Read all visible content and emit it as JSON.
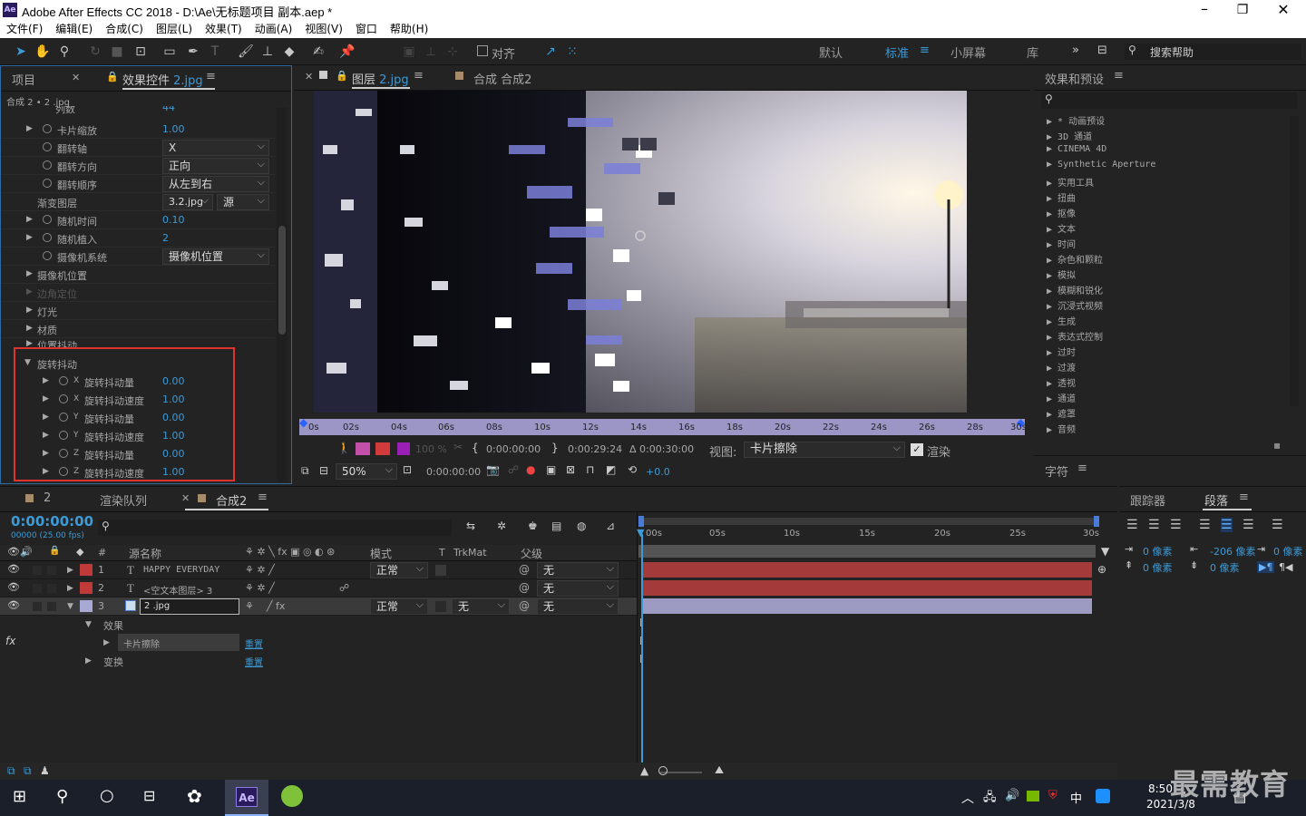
{
  "app": {
    "title": "Adobe After Effects CC 2018 - D:\\Ae\\无标题项目 副本.aep *",
    "logo": "Ae"
  },
  "menu": [
    "文件(F)",
    "编辑(E)",
    "合成(C)",
    "图层(L)",
    "效果(T)",
    "动画(A)",
    "视图(V)",
    "窗口",
    "帮助(H)"
  ],
  "toolbar": {
    "align_label": "对齐",
    "workspaces": [
      "默认",
      "标准",
      "小屏幕",
      "库"
    ],
    "search_placeholder": "搜索帮助"
  },
  "effect_controls": {
    "tab_project": "项目",
    "tab_effects": "效果控件",
    "tab_effects_file": "2.jpg",
    "breadcrumb": "合成 2 • 2 .jpg",
    "partial_row": {
      "label": "列数",
      "value": "44"
    },
    "rows": [
      {
        "label": "卡片缩放",
        "value": "1.00",
        "kind": "value"
      },
      {
        "label": "翻转轴",
        "value": "X",
        "kind": "select"
      },
      {
        "label": "翻转方向",
        "value": "正向",
        "kind": "select"
      },
      {
        "label": "翻转顺序",
        "value": "从左到右",
        "kind": "select"
      },
      {
        "label": "渐变图层",
        "value": "3.2.jpg",
        "value2": "源",
        "kind": "select2"
      },
      {
        "label": "随机时间",
        "value": "0.10",
        "kind": "value"
      },
      {
        "label": "随机植入",
        "value": "2",
        "kind": "value"
      },
      {
        "label": "摄像机系统",
        "value": "摄像机位置",
        "kind": "select"
      }
    ],
    "groups": [
      "摄像机位置",
      "边角定位",
      "灯光",
      "材质",
      "位置抖动"
    ],
    "rotation_group": "旋转抖动",
    "rotation_rows": [
      {
        "axis": "X",
        "label": "旋转抖动量",
        "value": "0.00"
      },
      {
        "axis": "X",
        "label": "旋转抖动速度",
        "value": "1.00"
      },
      {
        "axis": "Y",
        "label": "旋转抖动量",
        "value": "0.00"
      },
      {
        "axis": "Y",
        "label": "旋转抖动速度",
        "value": "1.00"
      },
      {
        "axis": "Z",
        "label": "旋转抖动量",
        "value": "0.00"
      },
      {
        "axis": "Z",
        "label": "旋转抖动速度",
        "value": "1.00"
      }
    ]
  },
  "viewer": {
    "tab_layer": "图层",
    "tab_layer_file": "2.jpg",
    "tab_comp": "合成 合成2",
    "ruler_ticks": [
      "0s",
      "02s",
      "04s",
      "06s",
      "08s",
      "10s",
      "12s",
      "14s",
      "16s",
      "18s",
      "20s",
      "22s",
      "24s",
      "26s",
      "28s",
      "30s"
    ],
    "opacity": "100 %",
    "in_time": "0:00:00:00",
    "out_time": "0:00:29:24",
    "duration": "Δ 0:00:30:00",
    "view_label": "视图:",
    "view_value": "卡片擦除",
    "render_label": "渲染",
    "zoom": "50%",
    "current_time": "0:00:00:00",
    "exposure": "+0.0"
  },
  "effects_presets": {
    "title": "效果和预设",
    "items": [
      "* 动画预设",
      "3D 通道",
      "CINEMA 4D",
      "Synthetic Aperture",
      "实用工具",
      "扭曲",
      "抠像",
      "文本",
      "时间",
      "杂色和颗粒",
      "模拟",
      "模糊和锐化",
      "沉浸式视频",
      "生成",
      "表达式控制",
      "过时",
      "过渡",
      "透视",
      "通道",
      "遮罩",
      "音频"
    ]
  },
  "character_panel": {
    "title": "字符"
  },
  "timeline": {
    "tabs": [
      "2",
      "渲染队列",
      "合成2"
    ],
    "timecode": "0:00:00:00",
    "fps": "00000 (25.00 fps)",
    "columns": {
      "num": "#",
      "source": "源名称",
      "mode": "模式",
      "t": "T",
      "trkmat": "TrkMat",
      "parent": "父级"
    },
    "layers": [
      {
        "num": "1",
        "type": "T",
        "name": "HAPPY EVERYDAY",
        "mode": "正常",
        "trkmat": "",
        "parent": "无",
        "color": "#c03a3a"
      },
      {
        "num": "2",
        "type": "T",
        "name": "<空文本图层> 3",
        "mode": "",
        "trkmat": "",
        "parent": "无",
        "color": "#c03a3a"
      },
      {
        "num": "3",
        "type": "img",
        "name": "2 .jpg",
        "mode": "正常",
        "trkmat": "无",
        "parent": "无",
        "color": "#a9a9d6"
      }
    ],
    "sub_effects": "效果",
    "sub_card_wipe": "卡片擦除",
    "sub_transform": "变换",
    "reset": "重置",
    "ruler": [
      "00s",
      "05s",
      "10s",
      "15s",
      "20s",
      "25s",
      "30s"
    ]
  },
  "paragraph": {
    "tab_tracker": "跟踪器",
    "tab_paragraph": "段落",
    "indent_left": "0 像素",
    "indent_first": "-206 像素",
    "indent_right": "0 像素",
    "space_before": "0 像素",
    "space_after": "0 像素"
  },
  "taskbar": {
    "time": "8:50",
    "date": "2021/3/8",
    "ime": "中",
    "app": "Ae"
  },
  "watermark": "最需教育"
}
